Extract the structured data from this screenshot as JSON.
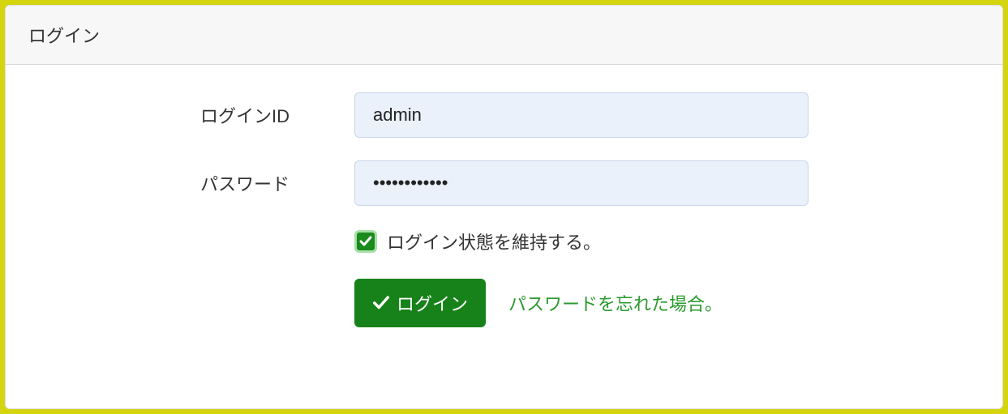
{
  "panel": {
    "title": "ログイン"
  },
  "form": {
    "login_id_label": "ログインID",
    "login_id_value": "admin",
    "password_label": "パスワード",
    "password_value": "••••••••••••",
    "remember_label": "ログイン状態を維持する。",
    "remember_checked": true,
    "submit_label": "ログイン",
    "forgot_label": "パスワードを忘れた場合。"
  },
  "colors": {
    "accent": "#18821a",
    "page_bg": "#d4d40f",
    "input_bg": "#eaf1fb"
  }
}
